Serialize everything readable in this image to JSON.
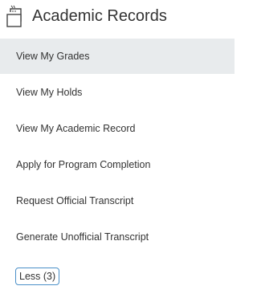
{
  "header": {
    "title": "Academic Records",
    "icon": "transcript-icon"
  },
  "menu": {
    "items": [
      {
        "label": "View My Grades",
        "active": true
      },
      {
        "label": "View My Holds",
        "active": false
      },
      {
        "label": "View My Academic Record",
        "active": false
      },
      {
        "label": "Apply for Program Completion",
        "active": false
      },
      {
        "label": "Request Official Transcript",
        "active": false
      },
      {
        "label": "Generate Unofficial Transcript",
        "active": false
      }
    ]
  },
  "less_button": {
    "label": "Less (3)"
  },
  "colors": {
    "active_background": "#e8ebed",
    "text": "#333333",
    "focus_border": "#4a90c8"
  }
}
